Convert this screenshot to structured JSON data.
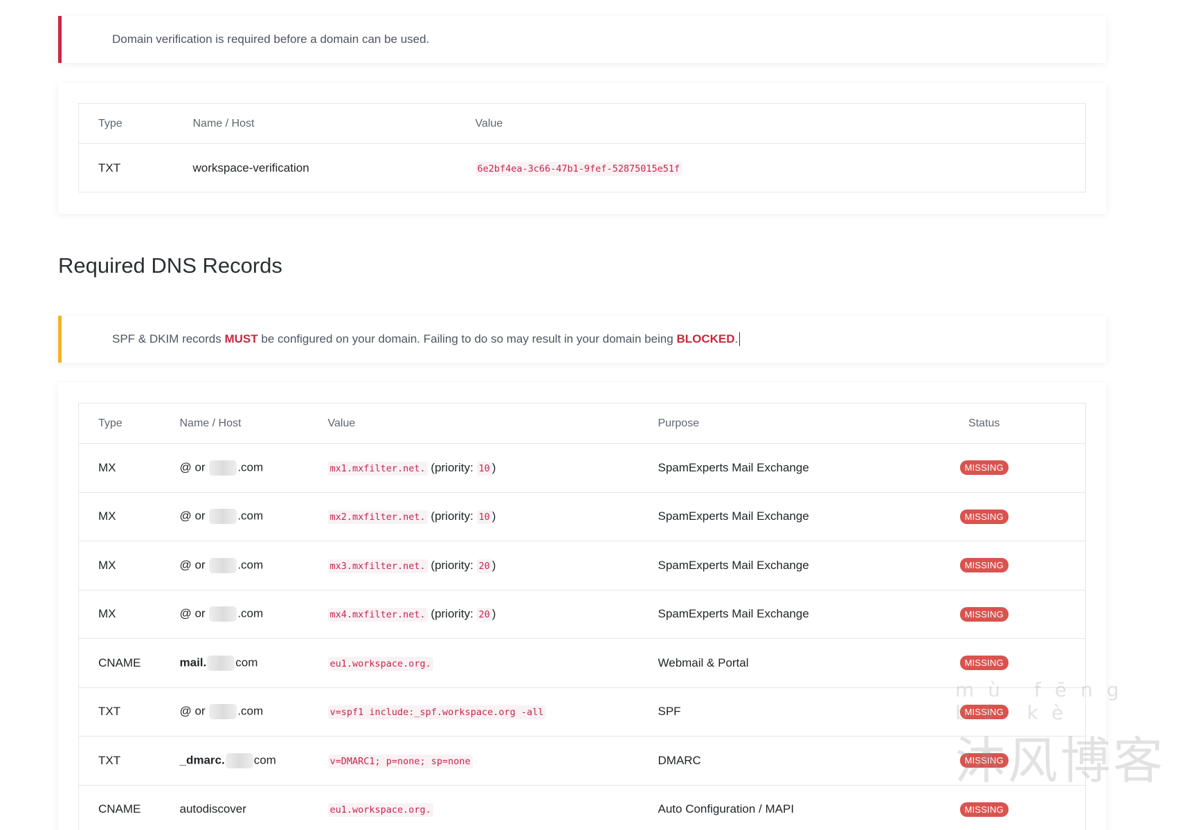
{
  "verify_alert": {
    "text": "Domain verification is required before a domain can be used."
  },
  "verify_table": {
    "headers": [
      "Type",
      "Name / Host",
      "Value"
    ],
    "row": {
      "type": "TXT",
      "host": "workspace-verification",
      "value": "6e2bf4ea-3c66-47b1-9fef-52875015e51f"
    }
  },
  "section_title": "Required DNS Records",
  "warning_alert": {
    "prefix": "SPF & DKIM records ",
    "must": "MUST",
    "middle": " be configured on your domain. Failing to do so may result in your domain being ",
    "blocked": "BLOCKED",
    "suffix": "."
  },
  "records_table": {
    "headers": [
      "Type",
      "Name / Host",
      "Value",
      "Purpose",
      "Status"
    ],
    "priority_label": "(priority: ",
    "priority_close": ")",
    "rows": [
      {
        "type": "MX",
        "host_prefix": "@ or ",
        "host_suffix": ".com",
        "value": "mx1.mxfilter.net.",
        "priority": "10",
        "purpose": "SpamExperts Mail Exchange",
        "status": "MISSING"
      },
      {
        "type": "MX",
        "host_prefix": "@ or ",
        "host_suffix": ".com",
        "value": "mx2.mxfilter.net.",
        "priority": "10",
        "purpose": "SpamExperts Mail Exchange",
        "status": "MISSING"
      },
      {
        "type": "MX",
        "host_prefix": "@ or ",
        "host_suffix": ".com",
        "value": "mx3.mxfilter.net.",
        "priority": "20",
        "purpose": "SpamExperts Mail Exchange",
        "status": "MISSING"
      },
      {
        "type": "MX",
        "host_prefix": "@ or ",
        "host_suffix": ".com",
        "value": "mx4.mxfilter.net.",
        "priority": "20",
        "purpose": "SpamExperts Mail Exchange",
        "status": "MISSING"
      },
      {
        "type": "CNAME",
        "host_bold": "mail.",
        "host_suffix": "com",
        "value": "eu1.workspace.org.",
        "purpose": "Webmail & Portal",
        "status": "MISSING"
      },
      {
        "type": "TXT",
        "host_prefix": "@ or ",
        "host_suffix": ".com",
        "value": "v=spf1 include:_spf.workspace.org -all",
        "purpose": "SPF",
        "status": "MISSING"
      },
      {
        "type": "TXT",
        "host_bold": "_dmarc.",
        "host_suffix": "com",
        "value": "v=DMARC1; p=none; sp=none",
        "purpose": "DMARC",
        "status": "MISSING"
      },
      {
        "type": "CNAME",
        "host_plain": "autodiscover",
        "value": "eu1.workspace.org.",
        "purpose": "Auto Configuration / MAPI",
        "status": "MISSING"
      }
    ]
  },
  "watermark": {
    "pinyin": "mù fēng bó kè",
    "chinese": "沐风博客"
  },
  "colors": {
    "danger": "#c9283e",
    "warning": "#f0b429",
    "badge": "#d9534f",
    "code": "#c7254e"
  }
}
